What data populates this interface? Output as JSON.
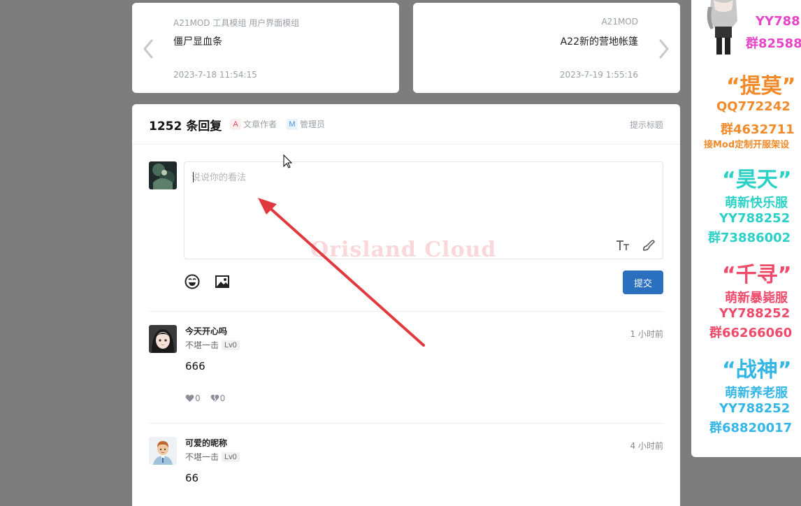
{
  "prev_post": {
    "tags": "A21MOD  工具模组  用户界面模组",
    "title": "僵尸显血条",
    "date": "2023-7-18 11:54:15"
  },
  "next_post": {
    "tags": "A21MOD",
    "title": "A22新的营地帐篷",
    "date": "2023-7-19 1:55:16"
  },
  "comments_header": {
    "count_label": "1252 条回复",
    "author_tag_letter": "A",
    "author_tag_label": "文章作者",
    "admin_tag_letter": "M",
    "admin_tag_label": "管理员",
    "hint_label": "提示标题"
  },
  "editor": {
    "placeholder": "说说你的看法",
    "watermark": "Orisland Cloud",
    "submit_label": "提交"
  },
  "comments": [
    {
      "name": "今天开心吗",
      "rank": "不堪一击",
      "level": "Lv0",
      "time": "1 小时前",
      "text": "666",
      "likes": "0",
      "dislikes": "0"
    },
    {
      "name": "可爱的昵称",
      "rank": "不堪一击",
      "level": "Lv0",
      "time": "4 小时前",
      "text": "66"
    }
  ],
  "ad": {
    "lines": [
      "YY788",
      "群82588",
      "“提莫”",
      "QQ772242",
      "群4632711",
      "接Mod定制开服架设",
      "“昊天”",
      "萌新快乐服",
      "YY788252",
      "群73886002",
      "“千寻”",
      "萌新暴毙服",
      "YY788252",
      "群66266060",
      "“战神”",
      "萌新养老服",
      "YY788252",
      "群68820017"
    ]
  },
  "colors": {
    "accent": "#2b6fbf",
    "annotation_arrow": "#e0393e",
    "background": "#7d7d7d"
  }
}
